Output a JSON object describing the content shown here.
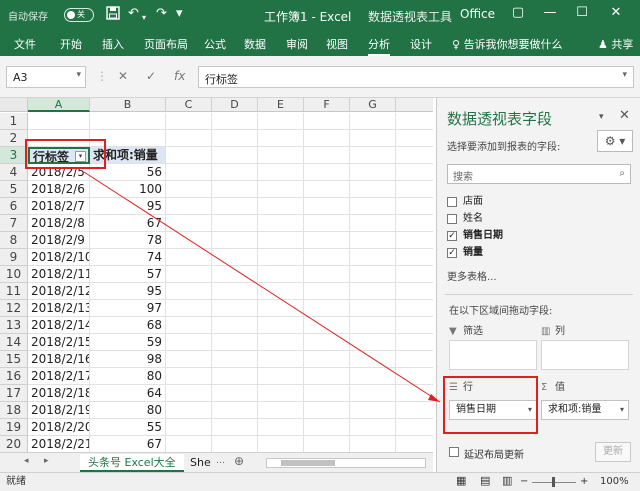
{
  "titlebar": {
    "autosave": "自动保存",
    "autosave_state": "关",
    "title": "工作簿1 - Excel",
    "context": "数据透视表工具",
    "product": "Office"
  },
  "ribbon": {
    "tabs": [
      "文件",
      "开始",
      "插入",
      "页面布局",
      "公式",
      "数据",
      "审阅",
      "视图",
      "分析",
      "设计"
    ],
    "tell_me": "告诉我你想要做什么",
    "share": "共享"
  },
  "formula_bar": {
    "name_box": "A3",
    "content": "行标签"
  },
  "grid": {
    "columns": [
      "A",
      "B",
      "C",
      "D",
      "E",
      "F",
      "G"
    ],
    "rows": [
      "1",
      "2",
      "3",
      "4",
      "5",
      "6",
      "7",
      "8",
      "9",
      "10",
      "11",
      "12",
      "13",
      "14",
      "15",
      "16",
      "17",
      "18",
      "19",
      "20"
    ],
    "pivot_header_label": "行标签",
    "pivot_header_value": "求和项:销量",
    "pivot_rows": [
      {
        "date": "2018/2/5",
        "value": "56"
      },
      {
        "date": "2018/2/6",
        "value": "100"
      },
      {
        "date": "2018/2/7",
        "value": "95"
      },
      {
        "date": "2018/2/8",
        "value": "67"
      },
      {
        "date": "2018/2/9",
        "value": "78"
      },
      {
        "date": "2018/2/10",
        "value": "74"
      },
      {
        "date": "2018/2/11",
        "value": "57"
      },
      {
        "date": "2018/2/12",
        "value": "95"
      },
      {
        "date": "2018/2/13",
        "value": "97"
      },
      {
        "date": "2018/2/14",
        "value": "68"
      },
      {
        "date": "2018/2/15",
        "value": "59"
      },
      {
        "date": "2018/2/16",
        "value": "98"
      },
      {
        "date": "2018/2/17",
        "value": "80"
      },
      {
        "date": "2018/2/18",
        "value": "64"
      },
      {
        "date": "2018/2/19",
        "value": "80"
      },
      {
        "date": "2018/2/20",
        "value": "55"
      },
      {
        "date": "2018/2/21",
        "value": "67"
      }
    ]
  },
  "sheet_tabs": {
    "active": "头条号 Excel大全",
    "other": "She"
  },
  "status": {
    "ready": "就绪",
    "zoom": "100%"
  },
  "pivot_pane": {
    "title": "数据透视表字段",
    "hint": "选择要添加到报表的字段:",
    "search_placeholder": "搜索",
    "fields": [
      {
        "name": "店面",
        "checked": false
      },
      {
        "name": "姓名",
        "checked": false
      },
      {
        "name": "销售日期",
        "checked": true
      },
      {
        "name": "销量",
        "checked": true
      }
    ],
    "more_tables": "更多表格...",
    "drag_hint": "在以下区域间拖动字段:",
    "areas": {
      "filter": "筛选",
      "columns": "列",
      "rows": "行",
      "values": "值"
    },
    "row_field": "销售日期",
    "value_field": "求和项:销量",
    "defer_update": "延迟布局更新",
    "update_button": "更新"
  }
}
